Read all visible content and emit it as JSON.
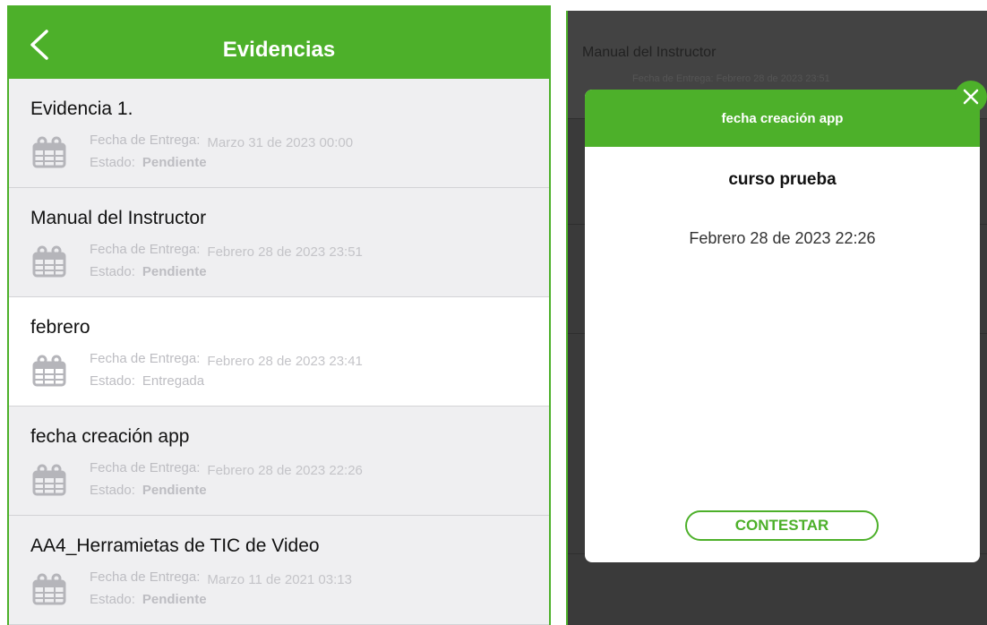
{
  "colors": {
    "accent": "#4db02a",
    "overlay": "#3a3a3a",
    "list_bg": "#efeff1"
  },
  "header": {
    "title": "Evidencias",
    "back_icon": "chevron-left-icon"
  },
  "labels": {
    "fecha": "Fecha de Entrega:",
    "estado": "Estado:"
  },
  "items": [
    {
      "title": "Evidencia 1.",
      "fecha": "Marzo 31 de 2023 00:00",
      "estado": "Pendiente"
    },
    {
      "title": "Manual del Instructor",
      "fecha": "Febrero 28 de 2023 23:51",
      "estado": "Pendiente"
    },
    {
      "title": "febrero",
      "fecha": "Febrero 28 de 2023 23:41",
      "estado": "Entregada"
    },
    {
      "title": "fecha creación app",
      "fecha": "Febrero 28 de 2023 22:26",
      "estado": "Pendiente"
    },
    {
      "title": "AA4_Herramietas de TIC de Video",
      "fecha": "Marzo 11 de 2021 03:13",
      "estado": "Pendiente"
    }
  ],
  "background": {
    "title": "Manual del Instructor",
    "fecha_label": "Fecha de Entrega:",
    "fecha": "Febrero 28 de 2023 23:51"
  },
  "modal": {
    "title": "fecha creación app",
    "course": "curso prueba",
    "date": "Febrero 28 de 2023 22:26",
    "button": "CONTESTAR",
    "close_icon": "close-icon"
  }
}
